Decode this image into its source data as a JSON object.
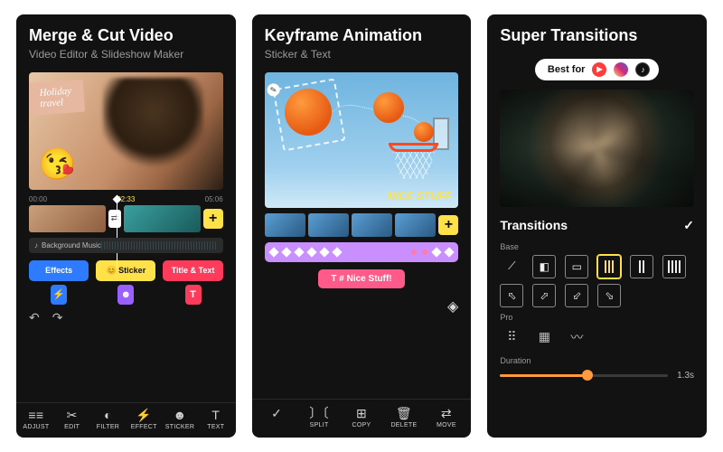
{
  "panel1": {
    "title": "Merge & Cut Video",
    "subtitle": "Video Editor & Slideshow Maker",
    "holiday_tag": "Holiday\ntravel",
    "emoji": "😘",
    "time_start": "00:00",
    "time_mid": "02:33",
    "time_end": "05:06",
    "transition_glyph": "⇄",
    "add_glyph": "+",
    "bg_music_icon": "♪",
    "bg_music_label": "Background Music",
    "pills": {
      "effects": {
        "emoji": "",
        "label": "Effects"
      },
      "sticker": {
        "emoji": "😊",
        "label": "Sticker"
      },
      "title": {
        "emoji": "",
        "label": "Title & Text"
      }
    },
    "drops": {
      "effects": "⚡",
      "sticker": "☻",
      "title": "T"
    },
    "undo_glyph": "↶",
    "redo_glyph": "↷",
    "bottom": [
      {
        "icon": "≡≡",
        "label": "ADJUST"
      },
      {
        "icon": "✂",
        "label": "EDIT"
      },
      {
        "icon": "◐",
        "label": "FILTER"
      },
      {
        "icon": "⚡",
        "label": "EFFECT"
      },
      {
        "icon": "☻",
        "label": "STICKER"
      },
      {
        "icon": "T",
        "label": "TEXT"
      }
    ]
  },
  "panel2": {
    "title": "Keyframe Animation",
    "subtitle": "Sticker & Text",
    "kf_handle_glyph": "✎",
    "nice_stuff_label": "NICE STUFF",
    "add_glyph": "+",
    "nice_pill": "T # Nice Stuff!",
    "kf_indicator_glyph": "◈",
    "bottom": [
      {
        "icon": "✓",
        "label": ""
      },
      {
        "icon": "〕〔",
        "label": "SPLIT"
      },
      {
        "icon": "⊞",
        "label": "COPY"
      },
      {
        "icon": "🗑",
        "label": "DELETE"
      },
      {
        "icon": "⇄",
        "label": "MOVE"
      }
    ]
  },
  "panel3": {
    "title": "Super Transitions",
    "best_for_label": "Best for",
    "best_for_yt_glyph": "▶",
    "best_for_tt_glyph": "♪",
    "transitions_header": "Transitions",
    "check_glyph": "✓",
    "base_label": "Base",
    "pro_label": "Pro",
    "duration_label": "Duration",
    "duration_value": "1.3s",
    "base_icons": {
      "none": "⟋",
      "fade": "◧",
      "slide": "▭",
      "bars": "∥∥",
      "bars2": "∥",
      "bars3": "∥∥∥",
      "tl": "⬁",
      "tr": "⬀",
      "bl": "⬃",
      "br": "⬂"
    },
    "pro_icons": {
      "dots": "⠿",
      "grid": "▦",
      "wave": "〰"
    }
  }
}
